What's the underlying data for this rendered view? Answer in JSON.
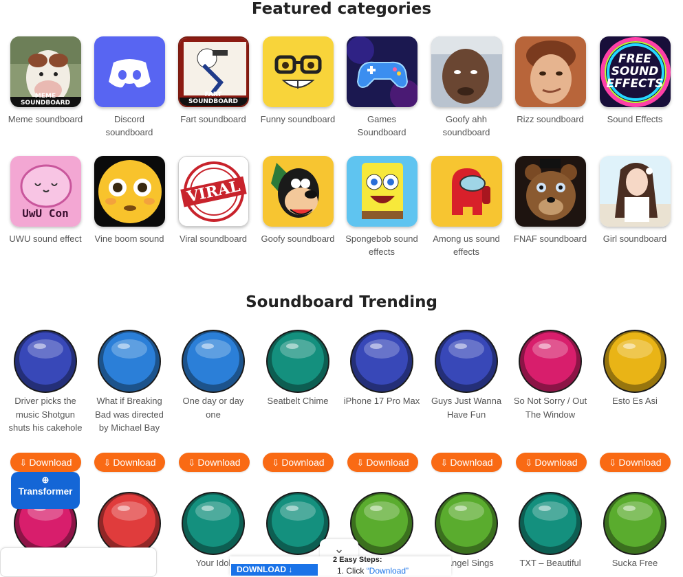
{
  "featured": {
    "title": "Featured categories",
    "row1": [
      {
        "label": "Meme soundboard",
        "caption": "MEME SOUNDBOARD"
      },
      {
        "label": "Discord soundboard"
      },
      {
        "label": "Fart soundboard",
        "caption": "FART SOUNDBOARD"
      },
      {
        "label": "Funny soundboard"
      },
      {
        "label": "Games Soundboard"
      },
      {
        "label": "Goofy ahh soundboard"
      },
      {
        "label": "Rizz soundboard"
      },
      {
        "label": "Sound Effects",
        "caption": "FREE SOUND EFFECTS"
      }
    ],
    "row2": [
      {
        "label": "UWU sound effect",
        "caption": "UwU Con"
      },
      {
        "label": "Vine boom sound"
      },
      {
        "label": "Viral soundboard",
        "caption": "VIRAL"
      },
      {
        "label": "Goofy soundboard"
      },
      {
        "label": "Spongebob sound effects"
      },
      {
        "label": "Among us sound effects"
      },
      {
        "label": "FNAF soundboard"
      },
      {
        "label": "Girl soundboard"
      }
    ]
  },
  "trending": {
    "title": "Soundboard Trending",
    "download_label": "Download",
    "row1": [
      {
        "label": "Driver picks the music Shotgun shuts his cakehole",
        "color": "#3848b8"
      },
      {
        "label": "What if Breaking Bad was directed by Michael Bay",
        "color": "#2b7fd8"
      },
      {
        "label": "One day or day one",
        "color": "#2b7fd8"
      },
      {
        "label": "Seatbelt Chime",
        "color": "#14907e"
      },
      {
        "label": "iPhone 17 Pro Max",
        "color": "#3848b8"
      },
      {
        "label": "Guys Just Wanna Have Fun",
        "color": "#3848b8"
      },
      {
        "label": "So Not Sorry / Out The Window",
        "color": "#d81e6c"
      },
      {
        "label": "Esto Es Asi",
        "color": "#e9b416"
      }
    ],
    "row2": [
      {
        "label": "",
        "color": "#d81e6c"
      },
      {
        "label": "",
        "color": "#e03c3c"
      },
      {
        "label": "Your Idol",
        "color": "#14907e"
      },
      {
        "label": "",
        "color": "#14907e"
      },
      {
        "label": "",
        "color": "#5aac2e"
      },
      {
        "label": "e Angel Sings",
        "color": "#5aac2e"
      },
      {
        "label": "TXT – Beautiful",
        "color": "#14907e"
      },
      {
        "label": "Sucka Free",
        "color": "#5aac2e"
      }
    ]
  },
  "overlay": {
    "transformer_label": "Transformer",
    "ad_download": "DOWNLOAD",
    "ad_steps_title": "2 Easy Steps:",
    "ad_step1_prefix": "1. Click",
    "ad_step1_link": "“Download”"
  }
}
